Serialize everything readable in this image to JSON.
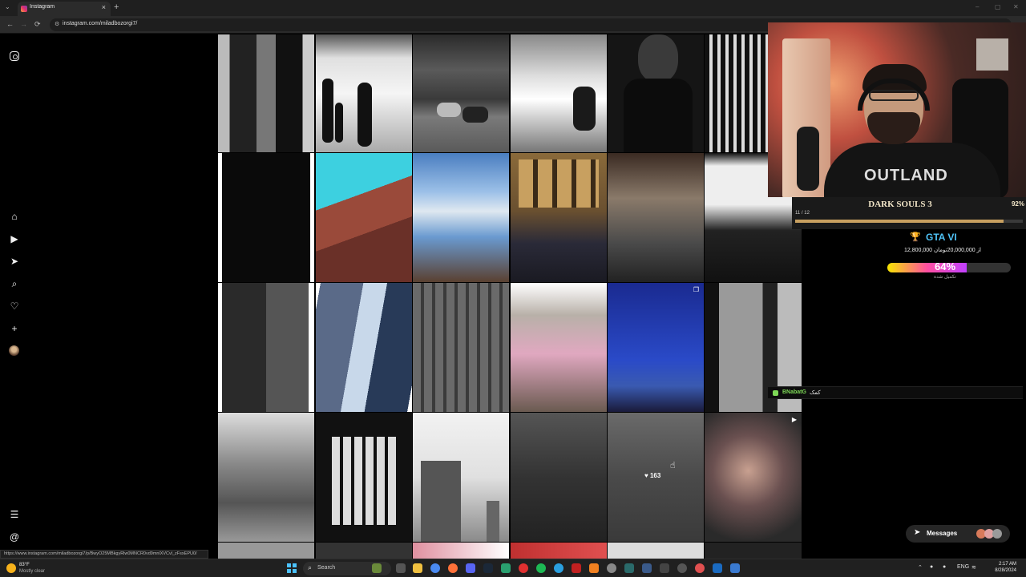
{
  "browser": {
    "tab_title": "Instagram",
    "tab_close": "×",
    "new_tab": "+",
    "url": "instagram.com/miladbozorgi7/",
    "back": "←",
    "forward": "→",
    "reload": "⟳",
    "window_controls": [
      "–",
      "▢",
      "✕"
    ]
  },
  "status_url": "https://www.instagram.com/miladbozorgi7/p/BwyO25MBkgyRlw0MNCR0vd9mnlXVCvl_zFsxEPU0/",
  "grid": {
    "hover_likes": "163",
    "colors": {
      "background": "#000000",
      "accent": "#e1306c"
    }
  },
  "stream": {
    "game": {
      "name": "DARK SOULS 3",
      "percent_label": "92%",
      "progress_label": "11 / 12",
      "progress_fraction": 0.9167
    },
    "goal": {
      "title": "GTA VI",
      "amount_text": "12,800,000 از 20,000,000تومان",
      "percent_label": "64%",
      "percent_value": 0.64,
      "done_label": "تکمیل شده"
    },
    "chat": {
      "user": "BNabatG",
      "message": "کمک"
    },
    "shirt_text": "OUTLAND"
  },
  "messages": {
    "label": "Messages"
  },
  "taskbar": {
    "weather_temp": "83°F",
    "weather_desc": "Mostly clear",
    "search_label": "Search",
    "lang": "ENG",
    "time": "2:17 AM",
    "date": "8/28/2024"
  }
}
